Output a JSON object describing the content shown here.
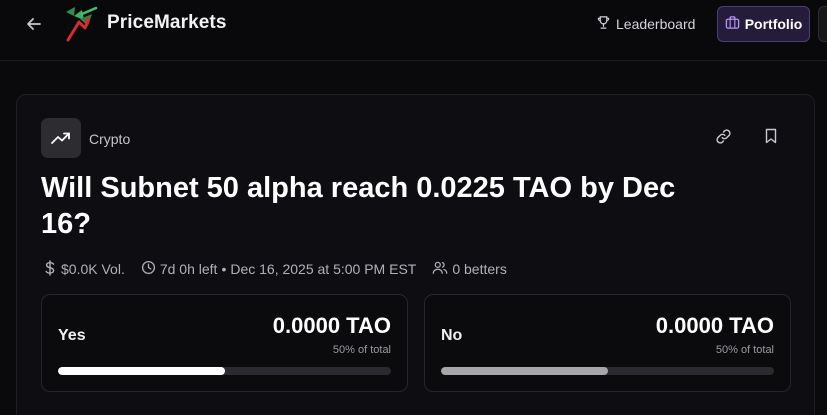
{
  "header": {
    "brand": "PriceMarkets",
    "leaderboard_label": "Leaderboard",
    "portfolio_label": "Portfolio"
  },
  "market": {
    "category": "Crypto",
    "category_icon": "trending-up-icon",
    "title": "Will Subnet 50 alpha reach 0.0225 TAO by Dec 16?",
    "volume": "$0.0K Vol.",
    "time_left": "7d 0h left",
    "separator": "•",
    "end_date": "Dec 16, 2025 at 5:00 PM EST",
    "betters": "0 betters"
  },
  "outcomes": [
    {
      "label": "Yes",
      "value": "0.0000 TAO",
      "share_text": "50% of total",
      "share": 0.5,
      "color": "#ffffff"
    },
    {
      "label": "No",
      "value": "0.0000 TAO",
      "share_text": "50% of total",
      "share": 0.5,
      "color": "#a6a6ab"
    }
  ],
  "colors": {
    "background": "#0a0a0d",
    "card": "#0e0e12",
    "accent_purple": "#4b3d77"
  }
}
